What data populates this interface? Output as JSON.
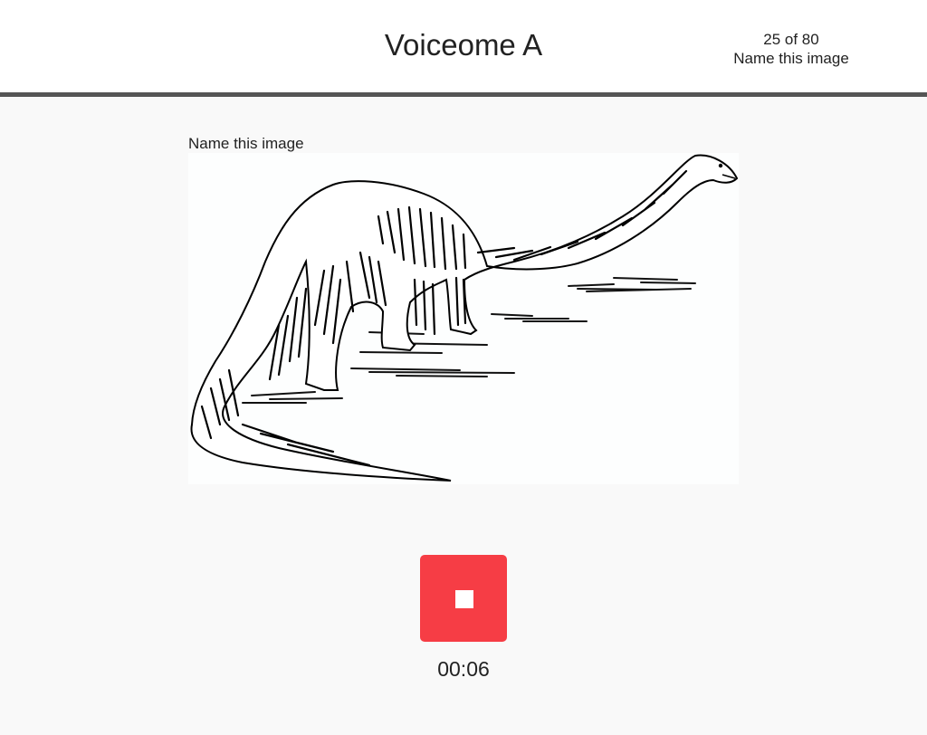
{
  "header": {
    "title": "Voiceome A",
    "progress_count": "25 of 80",
    "progress_task": "Name this image"
  },
  "task": {
    "prompt": "Name this image",
    "image_subject": "dinosaur-illustration"
  },
  "recorder": {
    "stop_icon": "stop-icon",
    "button_color": "#f63d45",
    "elapsed": "00:06"
  }
}
